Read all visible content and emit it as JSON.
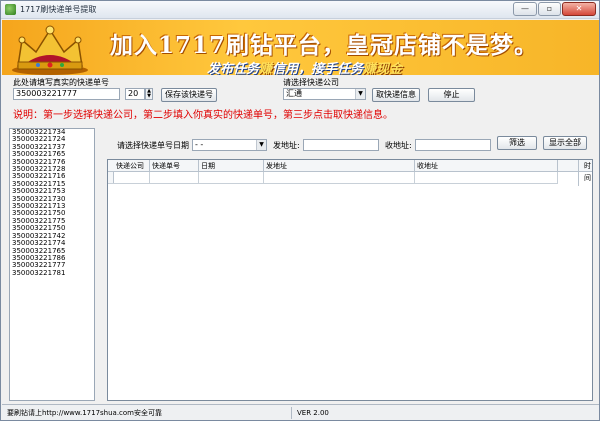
{
  "window": {
    "title": "1717刷快递单号提取",
    "icon": "app-logo-icon",
    "min_glyph": "—",
    "max_glyph": "▫",
    "close_glyph": "✕"
  },
  "banner": {
    "headline": "加入1717刷钻平台，皇冠店铺不是梦。",
    "sub_a": "发布任务",
    "sub_hl_a": "赚",
    "sub_b": "信用，接手任务",
    "sub_hl_b": "赚现金"
  },
  "form": {
    "tracking_label": "此处请填写真实的快递单号",
    "tracking_value": "350003221777",
    "count_value": "20",
    "generate_button": "保存该快递号",
    "company_label": "请选择快递公司",
    "company_selected": "汇通",
    "fetch_button": "取快递信息",
    "stop_button": "停止"
  },
  "notice": "说明：第一步选择快递公司，第二步填入你真实的快递单号，第三步点击取快递信息。",
  "tracking_list": [
    "350003221734",
    "350003221724",
    "350003221737",
    "350003221765",
    "350003221776",
    "350003221728",
    "350003221716",
    "350003221715",
    "350003221753",
    "350003221730",
    "350003221713",
    "350003221750",
    "350003221775",
    "350003221750",
    "350003221742",
    "350003221774",
    "350003221765",
    "350003221786",
    "350003221777",
    "350003221781"
  ],
  "filter": {
    "date_label": "请选择快递单号日期",
    "date_value": " - - ",
    "from_label": "发地址:",
    "from_value": "",
    "to_label": "收地址:",
    "to_value": "",
    "filter_button": "筛选",
    "show_all_button": "显示全部"
  },
  "grid": {
    "columns": [
      "快递公司",
      "快递单号",
      "日期",
      "发地址",
      "收地址"
    ],
    "side_column": "时间"
  },
  "status": {
    "left": "要刷钻请上http://www.1717shua.com安全可靠",
    "right": "VER 2.00"
  }
}
